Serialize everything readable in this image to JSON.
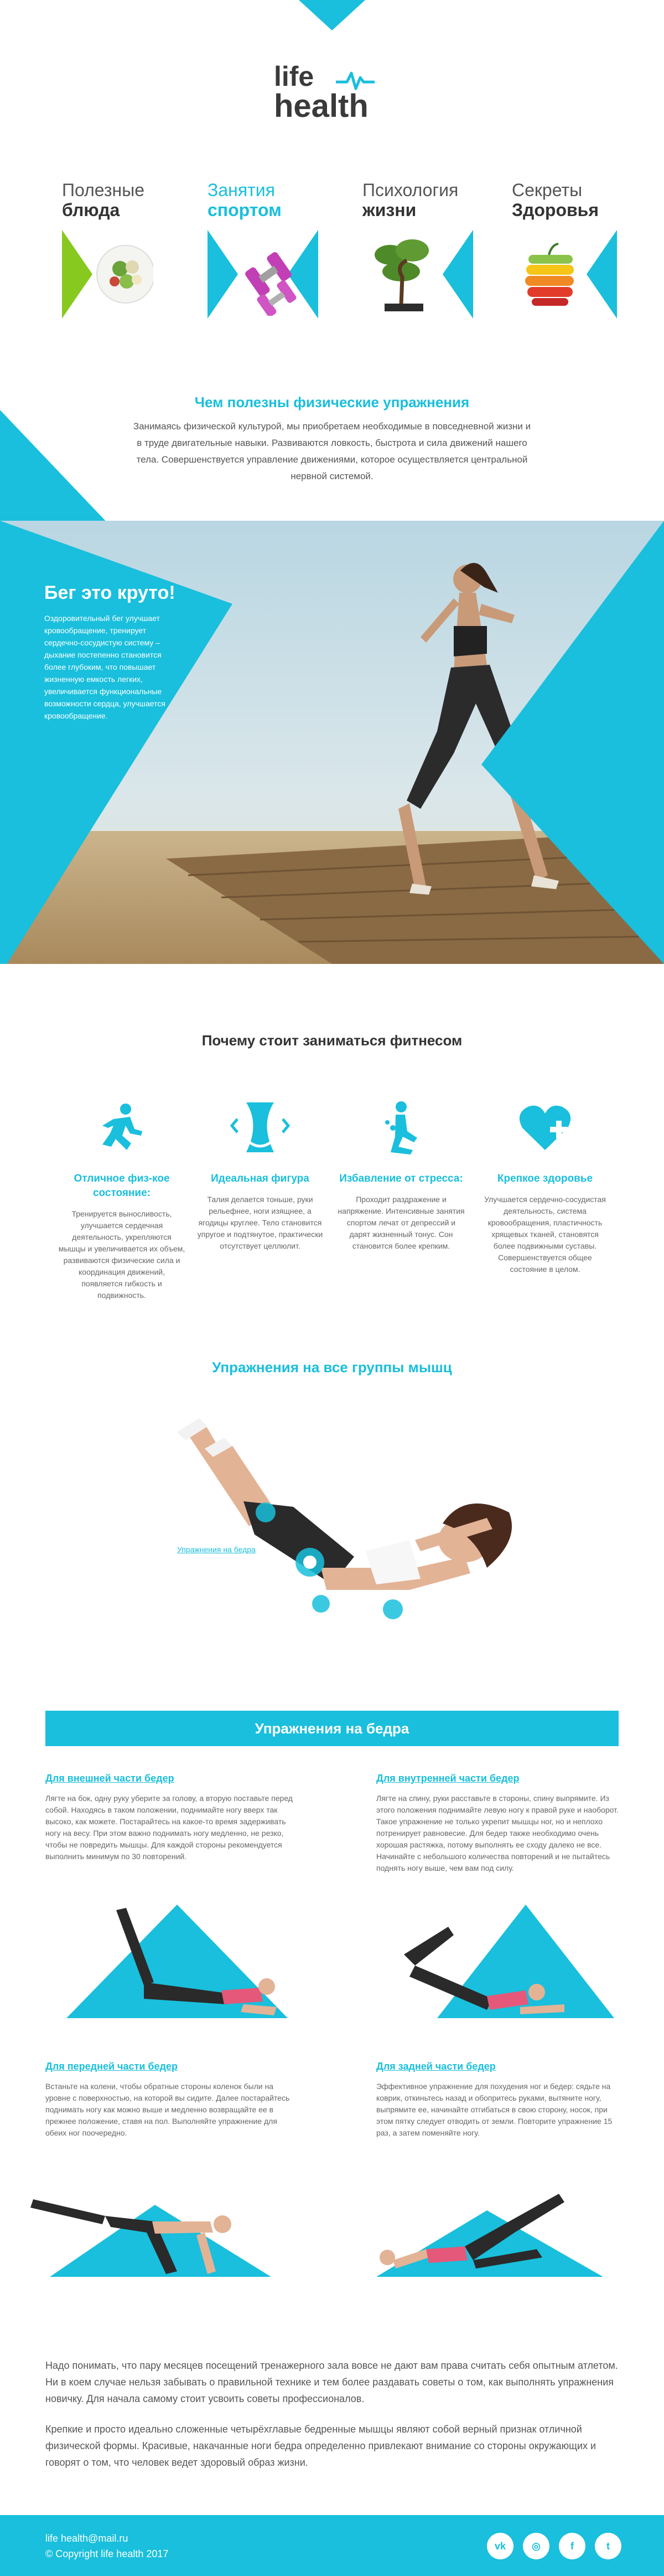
{
  "logo": {
    "line1": "life",
    "line2": "health"
  },
  "categories": [
    {
      "t1": "Полезные",
      "t2": "блюда",
      "icon": "salad-icon"
    },
    {
      "t1": "Занятия",
      "t2": "спортом",
      "icon": "dumbbell-icon"
    },
    {
      "t1": "Психология",
      "t2": "жизни",
      "icon": "bonsai-icon"
    },
    {
      "t1": "Секреты",
      "t2": "Здоровья",
      "icon": "fruit-icon"
    }
  ],
  "intro": {
    "title": "Чем полезны физические упражнения",
    "text": "Занимаясь физической культурой, мы приобретаем необходимые в повседневной жизни и в труде двигательные навыки. Развиваются ловкость, быстрота и сила движений нашего тела. Совершенствуется управление движениями, которое осуществляется центральной нервной системой."
  },
  "hero": {
    "title": "Бег это круто!",
    "text": "Оздоровительный бег улучшает кровообращение, тренирует сердечно-сосудистую систему – дыхание постепенно становится более глубоким, что повышает жизненную емкость легких, увеличивается функциональные возможности сердца, улучшается кровообращение."
  },
  "fitness": {
    "title": "Почему стоит заниматься фитнесом",
    "features": [
      {
        "title": "Отличное физ-кое состояние:",
        "text": "Тренируется выносливость, улучшается сердечная деятельность, укрепляются мышцы и увеличивается их объем, развиваются физические сила и координация движений, появляется гибкость и подвижность.",
        "icon": "running-man-icon"
      },
      {
        "title": "Идеальная фигура",
        "text": "Талия делается тоньше, руки рельефнее, ноги изящнее, а ягодицы круглее. Тело становится упругое и подтянутое, практически отсутствует целлюлит.",
        "icon": "waist-icon"
      },
      {
        "title": "Избавление от стресса:",
        "text": "Проходит раздражение и напряжение. Интенсивные занятия спортом лечат от депрессий и дарят жизненный тонус. Сон становится более крепким.",
        "icon": "meditation-icon"
      },
      {
        "title": "Крепкое здоровье",
        "text": "Улучшается сердечно-сосудистая деятельность, система кровообращения, пластичность хрящевых тканей, становятся более подвижными суставы. Совершенствуется общее состояние в целом.",
        "icon": "heart-plus-icon"
      }
    ]
  },
  "muscles": {
    "title": "Упражнения на все группы мышц",
    "link": "Упражнения на бедра"
  },
  "hips": {
    "banner": "Упражнения на бедра",
    "ex1": {
      "title": "Для внешней части бедер",
      "text": "Лягте на бок, одну руку уберите за голову, а вторую поставьте перед собой. Находясь в таком положении, поднимайте ногу вверх так высоко, как можете. Постарайтесь на какое-то время задерживать ногу на весу. При этом важно поднимать ногу медленно, не резко, чтобы не повредить мышцы. Для каждой стороны рекомендуется выполнить минимум по 30 повторений."
    },
    "ex2": {
      "title": "Для внутренней части бедер",
      "text": "Лягте на спину, руки расставьте в стороны, спину выпрямите. Из этого положения поднимайте левую ногу к правой руке и наоборот. Такое упражнение не только укрепит мышцы ног, но и неплохо потренирует равновесие. Для бедер также необходимо очень хорошая растяжка, потому выполнять ее сходу далеко не все. Начинайте с небольшого количества повторений и не пытайтесь поднять ногу выше, чем вам под силу."
    },
    "ex3": {
      "title": "Для передней части бедер",
      "text": "Встаньте на колени, чтобы обратные стороны коленок были на уровне с поверхностью, на которой вы сидите. Далее постарайтесь поднимать ногу как можно выше и медленно возвращайте ее в прежнее положение, ставя на пол. Выполняйте упражнение для обеих ног поочередно."
    },
    "ex4": {
      "title": "Для задней части бедер",
      "text": "Эффективное упражнение для похудения ног и бедер: сядьте на коврик, откиньтесь назад и обопритесь руками, вытяните ногу, выпрямите ее, начинайте отгибаться в свою сторону, носок, при этом пятку следует отводить от земли. Повторите упражнение 15 раз, а затем поменяйте ногу."
    }
  },
  "bottom": {
    "p1": "Надо понимать, что пару месяцев посещений тренажерного зала вовсе не дают вам права считать себя опытным атлетом. Ни в коем случае нельзя забывать о правильной технике и тем более раздавать советы о том, как выполнять упражнения новичку. Для начала самому стоит усвоить советы профессионалов.",
    "p2": "Крепкие и просто идеально сложенные четырёхглавые бедренные мышцы являют собой верный признак отличной физической формы. Красивые, накачанные ноги бедра определенно привлекают внимание со стороны окружающих и говорят о том, что человек ведет здоровый образ жизни."
  },
  "footer": {
    "email": "life health@mail.ru",
    "copyright": "© Copyright life health 2017",
    "social": [
      "vk-icon",
      "instagram-icon",
      "facebook-icon",
      "twitter-icon"
    ],
    "social_glyphs": [
      "vk",
      "◎",
      "f",
      "t"
    ]
  },
  "colors": {
    "accent": "#19bfdc",
    "green": "#88c920"
  }
}
